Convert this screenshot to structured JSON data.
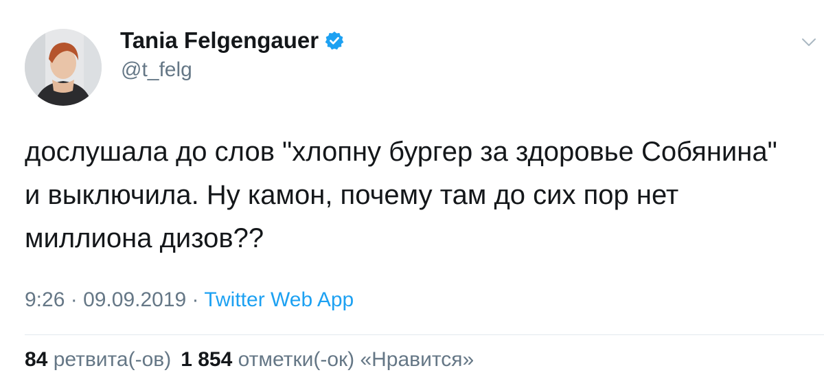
{
  "user": {
    "name": "Tania Felgengauer",
    "handle": "@t_felg",
    "verified": true
  },
  "tweet": {
    "lines": [
      "дослушала до слов \"хлопну бургер за здоровье Собянина\"",
      "и выключила. Ну камон, почему там до сих пор нет",
      "миллиона дизов??"
    ],
    "time": "9:26",
    "separator": " · ",
    "date": "09.09.2019",
    "source": "Twitter Web App"
  },
  "stats": {
    "retweets_count": "84",
    "retweets_label": "ретвита(-ов)",
    "likes_count": "1 854",
    "likes_label": "отметки(-ок) «Нравится»"
  },
  "colors": {
    "text": "#14171a",
    "secondary": "#657786",
    "accent": "#1da1f2",
    "divider": "#e1e8ed"
  },
  "icons": {
    "verified": "verified-badge-icon",
    "caret": "chevron-down-icon"
  }
}
